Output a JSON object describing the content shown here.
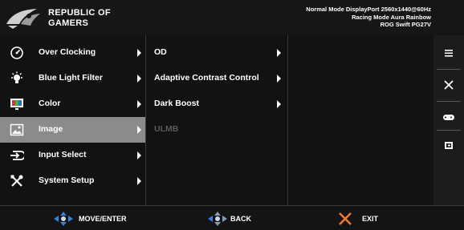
{
  "header": {
    "brand_line1": "REPUBLIC OF",
    "brand_line2": "GAMERS",
    "status_line1": "Normal Mode DisplayPort 2560x1440@60Hz",
    "status_line2": "Racing Mode Aura Rainbow",
    "status_line3": "ROG Swift PG27V"
  },
  "main_menu": [
    {
      "label": "Over Clocking",
      "icon": "speedometer-icon",
      "selected": false
    },
    {
      "label": "Blue Light Filter",
      "icon": "bulb-icon",
      "selected": false
    },
    {
      "label": "Color",
      "icon": "color-monitor-icon",
      "selected": false
    },
    {
      "label": "Image",
      "icon": "image-icon",
      "selected": true
    },
    {
      "label": "Input Select",
      "icon": "input-icon",
      "selected": false
    },
    {
      "label": "System Setup",
      "icon": "tools-icon",
      "selected": false
    }
  ],
  "sub_menu": [
    {
      "label": "OD",
      "enabled": true,
      "has_arrow": true
    },
    {
      "label": "Adaptive Contrast Control",
      "enabled": true,
      "has_arrow": true
    },
    {
      "label": "Dark Boost",
      "enabled": true,
      "has_arrow": true
    },
    {
      "label": "ULMB",
      "enabled": false,
      "has_arrow": false
    }
  ],
  "key_bar": [
    "menu-icon",
    "close-icon",
    "gamepad-icon",
    "gameplus-icon"
  ],
  "footer": {
    "move_label": "MOVE/ENTER",
    "back_label": "BACK",
    "exit_label": "EXIT"
  },
  "colors": {
    "background": "#141414",
    "selected": "#8b8b8b",
    "disabled_text": "#5a5a5a",
    "accent_blue": "#3a7fd8",
    "exit_orange": "#f07a2a"
  }
}
